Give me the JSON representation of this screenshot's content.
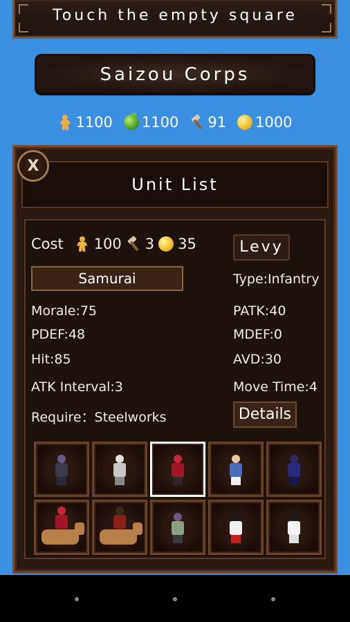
{
  "banner": {
    "text": "Touch the empty square"
  },
  "corps": {
    "name": "Saizou Corps"
  },
  "resources": [
    {
      "icon": "population-icon",
      "value": "1100"
    },
    {
      "icon": "food-icon",
      "value": "1100"
    },
    {
      "icon": "hammer-icon",
      "value": "91"
    },
    {
      "icon": "gold-coin-icon",
      "value": "1000"
    }
  ],
  "panel": {
    "title": "Unit List",
    "close_label": "X",
    "cost_label": "Cost",
    "cost": {
      "population": "100",
      "hammer": "3",
      "gold": "35"
    },
    "levy_label": "Levy",
    "unit_name": "Samurai",
    "stats": {
      "type": "Type:Infantry",
      "morale": "Morale:75",
      "patk": "PATK:40",
      "pdef": "PDEF:48",
      "mdef": "MDEF:0",
      "hit": "Hit:85",
      "avd": "AVD:30",
      "atk_interval": "ATK Interval:3",
      "move_time": "Move Time:4",
      "require": "Require：Steelworks"
    },
    "details_label": "Details"
  },
  "units": [
    {
      "name": "spearman-unit",
      "head": "#6a5a8a",
      "body": "#3a3a4a",
      "legs": "#2a2a3a"
    },
    {
      "name": "scythe-monk-unit",
      "head": "#e0e0e0",
      "body": "#c8c8c8",
      "legs": "#8a8a8a"
    },
    {
      "name": "samurai-unit",
      "head": "#c8283a",
      "body": "#a01828",
      "legs": "#2a2a2a",
      "selected": true
    },
    {
      "name": "ronin-unit",
      "head": "#e8c8a0",
      "body": "#4a6ab8",
      "legs": "#f0f0f0"
    },
    {
      "name": "ninja-unit",
      "head": "#2a2a6a",
      "body": "#2a2a7a",
      "legs": "#1a1a4a"
    },
    {
      "name": "cavalry-unit",
      "head": "#c8283a",
      "body": "#a01828",
      "legs": "#b88048",
      "horse": true
    },
    {
      "name": "mounted-archer-unit",
      "head": "#3a2a1a",
      "body": "#8a2018",
      "legs": "#b88048",
      "horse": true
    },
    {
      "name": "hooded-soldier-unit",
      "head": "#6a5a8a",
      "body": "#8aa080",
      "legs": "#3a3a3a"
    },
    {
      "name": "shrine-maiden-unit",
      "head": "#1a1a1a",
      "body": "#f0f0f0",
      "legs": "#c82020"
    },
    {
      "name": "onmyoji-unit",
      "head": "#1a1a1a",
      "body": "#f4f4f4",
      "legs": "#e0e0e0"
    }
  ]
}
